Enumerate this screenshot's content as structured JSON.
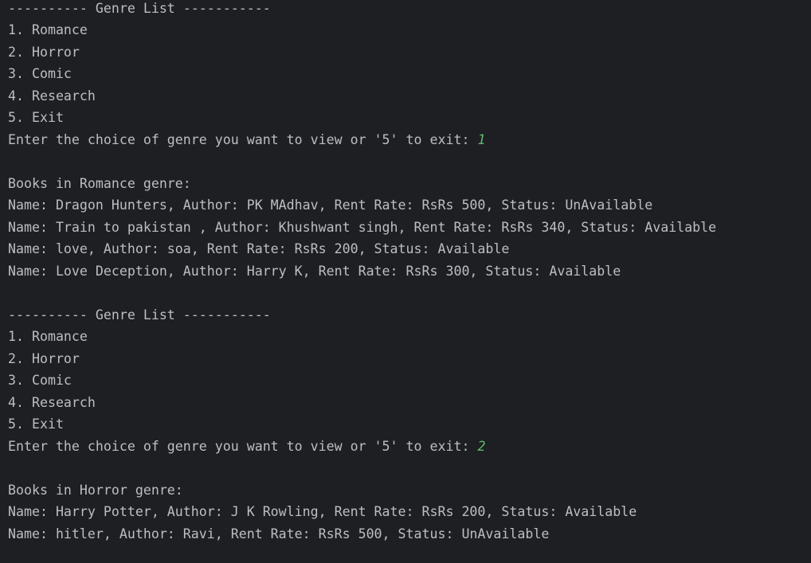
{
  "console": {
    "input_color": "#5fb870",
    "text_color": "#bcbec4",
    "background": "#1e1f22",
    "session1": {
      "genre_header": "---------- Genre List -----------",
      "options": [
        "1. Romance",
        "2. Horror",
        "3. Comic",
        "4. Research",
        "5. Exit"
      ],
      "prompt": "Enter the choice of genre you want to view or '5' to exit: ",
      "user_input": "1",
      "books_header": "Books in Romance genre:",
      "books": [
        "Name: Dragon Hunters, Author: PK MAdhav, Rent Rate: RsRs 500, Status: UnAvailable",
        "Name: Train to pakistan , Author: Khushwant singh, Rent Rate: RsRs 340, Status: Available",
        "Name: love, Author: soa, Rent Rate: RsRs 200, Status: Available",
        "Name: Love Deception, Author: Harry K, Rent Rate: RsRs 300, Status: Available"
      ]
    },
    "session2": {
      "genre_header": "---------- Genre List -----------",
      "options": [
        "1. Romance",
        "2. Horror",
        "3. Comic",
        "4. Research",
        "5. Exit"
      ],
      "prompt": "Enter the choice of genre you want to view or '5' to exit: ",
      "user_input": "2",
      "books_header": "Books in Horror genre:",
      "books": [
        "Name: Harry Potter, Author: J K Rowling, Rent Rate: RsRs 200, Status: Available",
        "Name: hitler, Author: Ravi, Rent Rate: RsRs 500, Status: UnAvailable"
      ]
    }
  }
}
